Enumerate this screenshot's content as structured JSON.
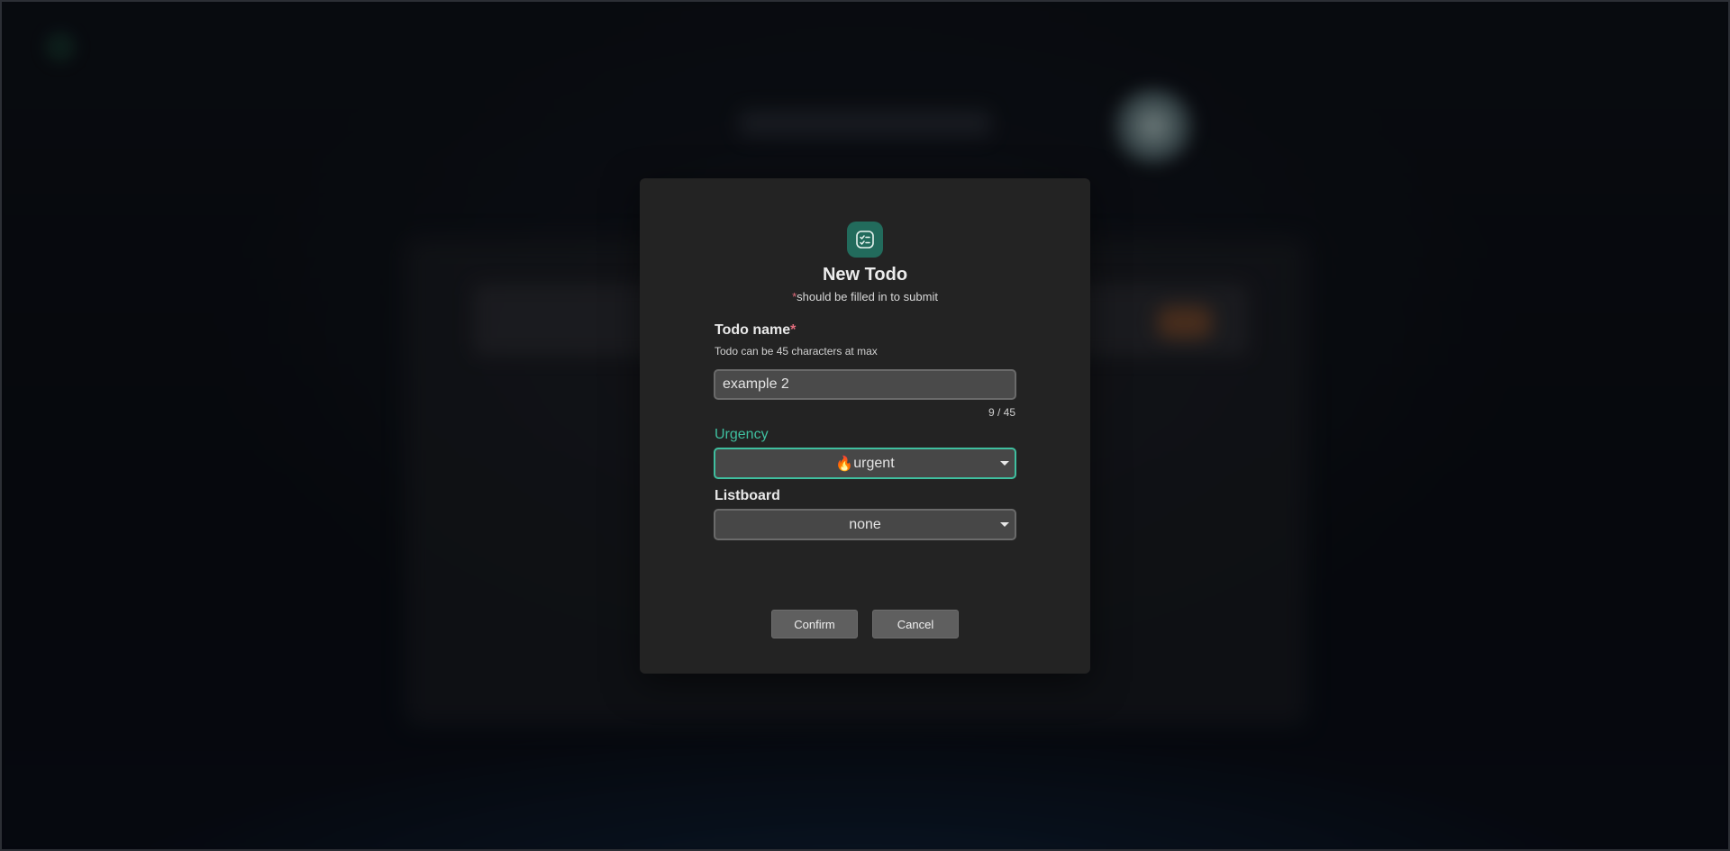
{
  "modal": {
    "title": "New Todo",
    "required_star": "*",
    "subtitle": "should be filled in to submit",
    "icon": "checklist-icon",
    "accent_color": "#3fbf9f"
  },
  "todo_name": {
    "label": "Todo name",
    "required_star": "*",
    "hint": "Todo can be 45 characters at max",
    "value": "example 2",
    "counter": "9 / 45"
  },
  "urgency": {
    "label": "Urgency",
    "emoji": "🔥",
    "selected": "urgent"
  },
  "listboard": {
    "label": "Listboard",
    "selected": "none"
  },
  "buttons": {
    "confirm": "Confirm",
    "cancel": "Cancel"
  }
}
